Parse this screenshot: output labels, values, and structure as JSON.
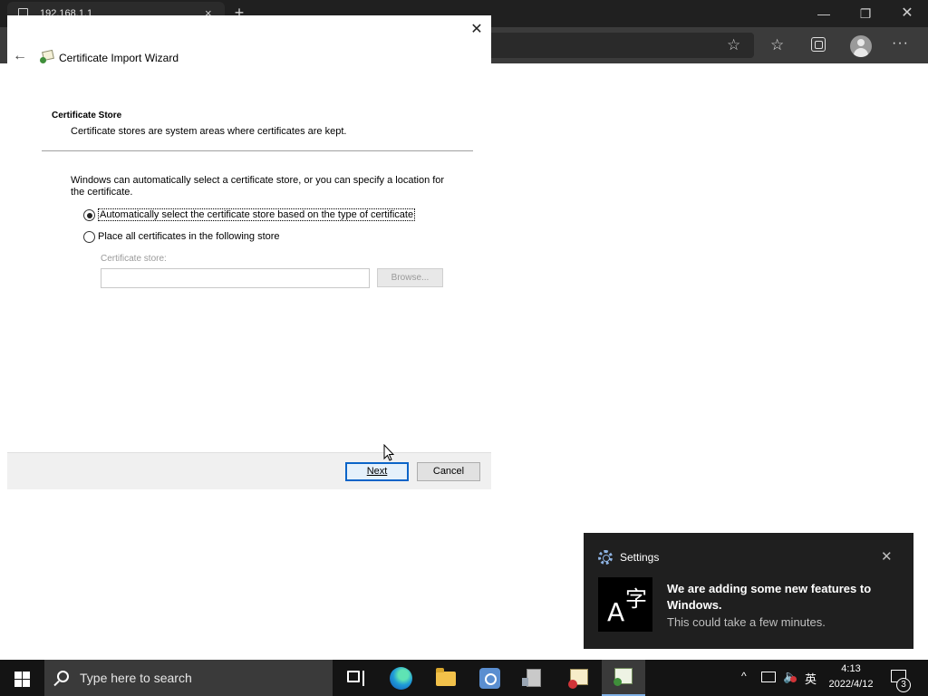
{
  "browser": {
    "tab_title": "192.168.1.1",
    "tab_close_glyph": "×",
    "new_tab_glyph": "+",
    "minimize_glyph": "—",
    "restore_glyph": "❐",
    "close_glyph": "✕",
    "favorite_glyph": "☆",
    "favorites_glyph": "☆",
    "more_glyph": "···"
  },
  "wizard": {
    "title": "Certificate Import Wizard",
    "close_glyph": "✕",
    "back_glyph": "←",
    "section_heading": "Certificate Store",
    "section_description": "Certificate stores are system areas where certificates are kept.",
    "intro_text": "Windows can automatically select a certificate store, or you can specify a location for the certificate.",
    "options": [
      {
        "label": "Automatically select the certificate store based on the type of certificate",
        "checked": true
      },
      {
        "label": "Place all certificates in the following store",
        "checked": false
      }
    ],
    "store_label": "Certificate store:",
    "store_value": "",
    "browse_label": "Browse...",
    "next_label": "Next",
    "cancel_label": "Cancel"
  },
  "toast": {
    "app_name": "Settings",
    "close_glyph": "✕",
    "title": "We are adding some new features to Windows.",
    "body": "This could take a few minutes.",
    "icon_letter": "A",
    "icon_glyph": "字"
  },
  "taskbar": {
    "search_placeholder": "Type here to search",
    "tray_chevron": "^",
    "volume_glyph": "🔈",
    "ime_label": "英",
    "time": "4:13",
    "date": "2022/4/12",
    "notification_count": "3"
  },
  "icons": {
    "start": "windows-logo",
    "task_view": "task-view-icon",
    "edge": "edge-browser-icon",
    "explorer": "file-explorer-icon",
    "settings": "settings-gear-icon",
    "server": "server-manager-icon",
    "cert_error": "certificate-error-icon",
    "cert_manager": "certificate-wizard-icon"
  },
  "colors": {
    "accent": "#0a64c8",
    "taskbar": "#141414",
    "toast_bg": "#1f1f1f",
    "browser_toolbar": "#3b3b3b"
  }
}
